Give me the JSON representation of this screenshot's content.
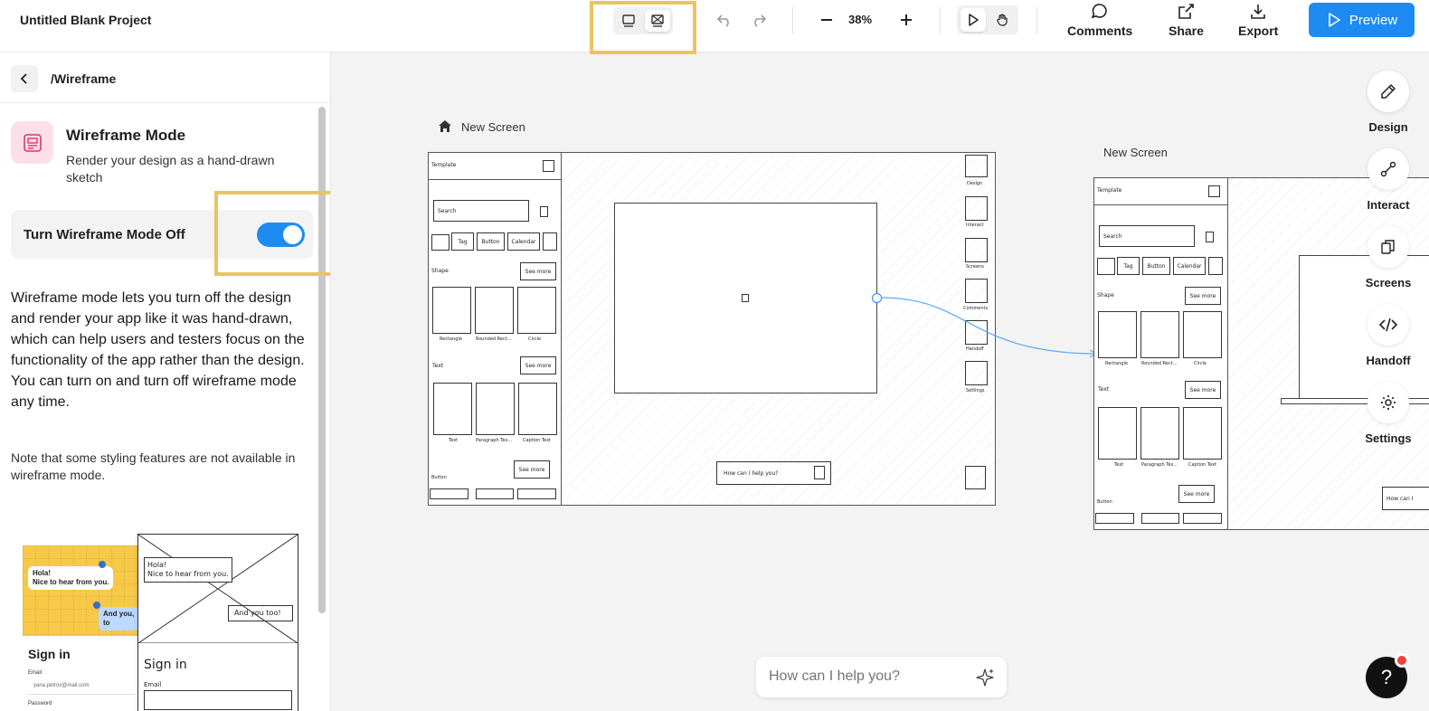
{
  "project": {
    "title": "Untitled Blank Project"
  },
  "toolbar": {
    "zoom": "38%",
    "actions": {
      "comments": "Comments",
      "share": "Share",
      "export": "Export"
    },
    "preview": "Preview"
  },
  "sidebar": {
    "breadcrumb": "/Wireframe",
    "feature": {
      "title": "Wireframe Mode",
      "description": "Render your design as a hand-drawn sketch"
    },
    "toggle": {
      "label": "Turn Wireframe Mode Off",
      "on": true
    },
    "body": "Wireframe mode lets you turn off the design and render your app like it was hand-drawn, which can help users and testers focus on the functionality of the app rather than the design.",
    "body2": "You can turn on and turn off wireframe mode any time.",
    "note": "Note that some styling features are not available in wireframe mode.",
    "preview": {
      "bubble1a": "Hola!",
      "bubble1b": "Nice to hear from you.",
      "bubble2": "And you, to",
      "signin": "Sign in",
      "email_label": "Email",
      "email_value": "yana.petrov@mail.com",
      "password_label": "Password",
      "wire_bubble1a": "Hola!",
      "wire_bubble1b": "Nice to hear from you.",
      "wire_bubble2": "And you too!",
      "wire_signin": "Sign in",
      "wire_email": "Email"
    }
  },
  "canvas": {
    "screen1_label": "New Screen",
    "screen2_label": "New Screen",
    "panel": {
      "template": "Template",
      "search": "Search",
      "chips": [
        "Tag",
        "Button",
        "Calendar"
      ],
      "shape_section": "Shape",
      "text_section": "Text",
      "button_section": "Button",
      "see_more": "See more",
      "shape_captions": [
        "Rectangle",
        "Rounded Rect...",
        "Circle"
      ],
      "text_captions": [
        "Text",
        "Paragraph Tex...",
        "Caption Text"
      ]
    },
    "rail_left": [
      "Design",
      "Interact",
      "Screens",
      "Comments",
      "Handoff",
      "Settings"
    ],
    "ai_prompt_small": "How can I help you?",
    "screen2_ai_small": "How can I"
  },
  "right_rail": {
    "items": [
      {
        "label": "Design",
        "icon": "pencil-icon"
      },
      {
        "label": "Interact",
        "icon": "interact-icon"
      },
      {
        "label": "Screens",
        "icon": "screens-icon"
      },
      {
        "label": "Handoff",
        "icon": "code-icon"
      },
      {
        "label": "Settings",
        "icon": "gear-icon"
      }
    ]
  },
  "assistant": {
    "placeholder": "How can I help you?"
  },
  "help": {
    "label": "?"
  },
  "colors": {
    "accent": "#1d8bf2",
    "highlight": "#e8c463",
    "feature_bg": "#fde0e7",
    "preview_yellow": "#f7c948"
  }
}
